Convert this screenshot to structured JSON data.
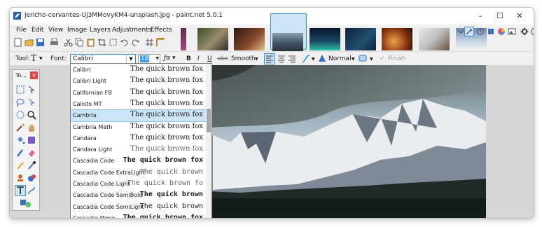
{
  "window": {
    "title": "jericho-cervantes-Uj3MMovyKM4-unsplash.jpg - paint.net 5.0.1",
    "minimize": "–",
    "maximize": "☐",
    "close": "✕"
  },
  "menu": [
    "File",
    "Edit",
    "View",
    "Image",
    "Layers",
    "Adjustments",
    "Effects"
  ],
  "options": {
    "tool_label": "Tool:",
    "tool_glyph": "T",
    "font_label": "Font:",
    "font_value": "Calibri",
    "size_value": "18",
    "bold": "B",
    "italic": "I",
    "underline": "U",
    "strike": "abc",
    "smoothing": "Smooth",
    "blend": "Normal",
    "finish": "Finish"
  },
  "tools_window": {
    "title": "To...",
    "close": "×"
  },
  "font_list": [
    {
      "name": "Calibri",
      "sample": "The quick brown fox",
      "style": "serif"
    },
    {
      "name": "Calibri Light",
      "sample": "The quick brown fox",
      "style": "serif"
    },
    {
      "name": "Californian FB",
      "sample": "The quick brown fox",
      "style": "serif"
    },
    {
      "name": "Calisto MT",
      "sample": "The quick brown fox",
      "style": "serif"
    },
    {
      "name": "Cambria",
      "sample": "The quick brown fox",
      "style": "serif",
      "selected": true
    },
    {
      "name": "Cambria Math",
      "sample": "The quick brown fox",
      "style": "serif"
    },
    {
      "name": "Candara",
      "sample": "The quick brown fox",
      "style": "serif"
    },
    {
      "name": "Candara Light",
      "sample": "The quick brown fox",
      "style": "light"
    },
    {
      "name": "Cascadia Code",
      "sample": "The quick brown fox",
      "style": "mono-bold"
    },
    {
      "name": "Cascadia Code ExtraLight",
      "sample": "The quick brown",
      "style": "mono-light"
    },
    {
      "name": "Cascadia Code Light",
      "sample": "The quick brown fo",
      "style": "mono-light"
    },
    {
      "name": "Cascadia Code SemiBold",
      "sample": "The quick brown",
      "style": "mono-bold"
    },
    {
      "name": "Cascadia Code SemiLight",
      "sample": "The quick brown",
      "style": "mono"
    },
    {
      "name": "Cascadia Mono",
      "sample": "The quick brown fox",
      "style": "mono-bold"
    }
  ],
  "colors": {
    "accent": "#3b8fd6",
    "selection": "#cce4f7",
    "close_red": "#e04343"
  }
}
